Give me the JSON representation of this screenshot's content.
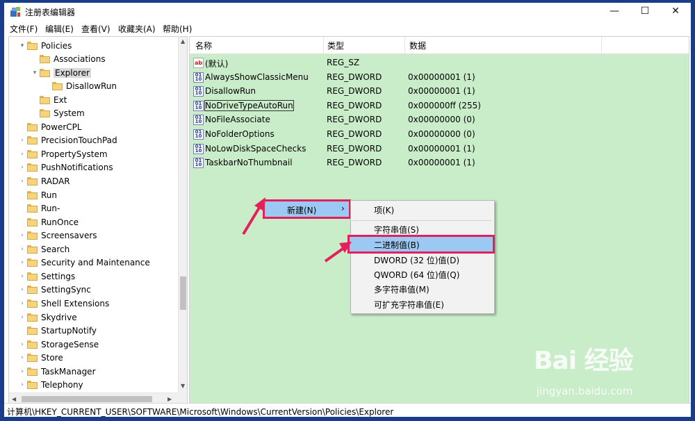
{
  "window": {
    "title": "注册表编辑器"
  },
  "controls": {
    "minimize": "—",
    "maximize": "☐",
    "close": "✕"
  },
  "menu": [
    "文件(F)",
    "编辑(E)",
    "查看(V)",
    "收藏夹(A)",
    "帮助(H)"
  ],
  "tree": [
    {
      "label": "Policies",
      "depth": 1,
      "exp": "open"
    },
    {
      "label": "Associations",
      "depth": 2,
      "exp": ""
    },
    {
      "label": "Explorer",
      "depth": 2,
      "exp": "open",
      "selected": true
    },
    {
      "label": "DisallowRun",
      "depth": 3,
      "exp": ""
    },
    {
      "label": "Ext",
      "depth": 2,
      "exp": ""
    },
    {
      "label": "System",
      "depth": 2,
      "exp": ""
    },
    {
      "label": "PowerCPL",
      "depth": 1,
      "exp": ""
    },
    {
      "label": "PrecisionTouchPad",
      "depth": 1,
      "exp": "closed"
    },
    {
      "label": "PropertySystem",
      "depth": 1,
      "exp": "closed"
    },
    {
      "label": "PushNotifications",
      "depth": 1,
      "exp": "closed"
    },
    {
      "label": "RADAR",
      "depth": 1,
      "exp": "closed"
    },
    {
      "label": "Run",
      "depth": 1,
      "exp": ""
    },
    {
      "label": "Run-",
      "depth": 1,
      "exp": ""
    },
    {
      "label": "RunOnce",
      "depth": 1,
      "exp": ""
    },
    {
      "label": "Screensavers",
      "depth": 1,
      "exp": "closed"
    },
    {
      "label": "Search",
      "depth": 1,
      "exp": "closed"
    },
    {
      "label": "Security and Maintenance",
      "depth": 1,
      "exp": "closed"
    },
    {
      "label": "Settings",
      "depth": 1,
      "exp": "closed"
    },
    {
      "label": "SettingSync",
      "depth": 1,
      "exp": "closed"
    },
    {
      "label": "Shell Extensions",
      "depth": 1,
      "exp": "closed"
    },
    {
      "label": "Skydrive",
      "depth": 1,
      "exp": "closed"
    },
    {
      "label": "StartupNotify",
      "depth": 1,
      "exp": ""
    },
    {
      "label": "StorageSense",
      "depth": 1,
      "exp": "closed"
    },
    {
      "label": "Store",
      "depth": 1,
      "exp": "closed"
    },
    {
      "label": "TaskManager",
      "depth": 1,
      "exp": "closed"
    },
    {
      "label": "Telephony",
      "depth": 1,
      "exp": "closed"
    }
  ],
  "columns": {
    "name": "名称",
    "type": "类型",
    "data": "数据"
  },
  "values": [
    {
      "name": "(默认)",
      "type": "REG_SZ",
      "data": "",
      "icon": "ab"
    },
    {
      "name": "AlwaysShowClassicMenu",
      "type": "REG_DWORD",
      "data": "0x00000001 (1)",
      "icon": "bin"
    },
    {
      "name": "DisallowRun",
      "type": "REG_DWORD",
      "data": "0x00000001 (1)",
      "icon": "bin"
    },
    {
      "name": "NoDriveTypeAutoRun",
      "type": "REG_DWORD",
      "data": "0x000000ff (255)",
      "icon": "bin",
      "focused": true
    },
    {
      "name": "NoFileAssociate",
      "type": "REG_DWORD",
      "data": "0x00000000 (0)",
      "icon": "bin"
    },
    {
      "name": "NoFolderOptions",
      "type": "REG_DWORD",
      "data": "0x00000000 (0)",
      "icon": "bin"
    },
    {
      "name": "NoLowDiskSpaceChecks",
      "type": "REG_DWORD",
      "data": "0x00000001 (1)",
      "icon": "bin"
    },
    {
      "name": "TaskbarNoThumbnail",
      "type": "REG_DWORD",
      "data": "0x00000001 (1)",
      "icon": "bin"
    }
  ],
  "context_menu": {
    "new_label": "新建(N)",
    "chevron": "›"
  },
  "submenu": {
    "key": "项(K)",
    "string": "字符串值(S)",
    "binary": "二进制值(B)",
    "dword": "DWORD (32 位)值(D)",
    "qword": "QWORD (64 位)值(Q)",
    "multi_string": "多字符串值(M)",
    "expandable_string": "可扩充字符串值(E)"
  },
  "status": {
    "path": "计算机\\HKEY_CURRENT_USER\\SOFTWARE\\Microsoft\\Windows\\CurrentVersion\\Policies\\Explorer"
  },
  "watermark": {
    "logo": "Bai 经验",
    "url": "jingyan.baidu.com"
  },
  "colors": {
    "highlight_border": "#e4205a",
    "menu_highlight": "#9cc9f4",
    "list_bg": "#c9ecc9"
  }
}
